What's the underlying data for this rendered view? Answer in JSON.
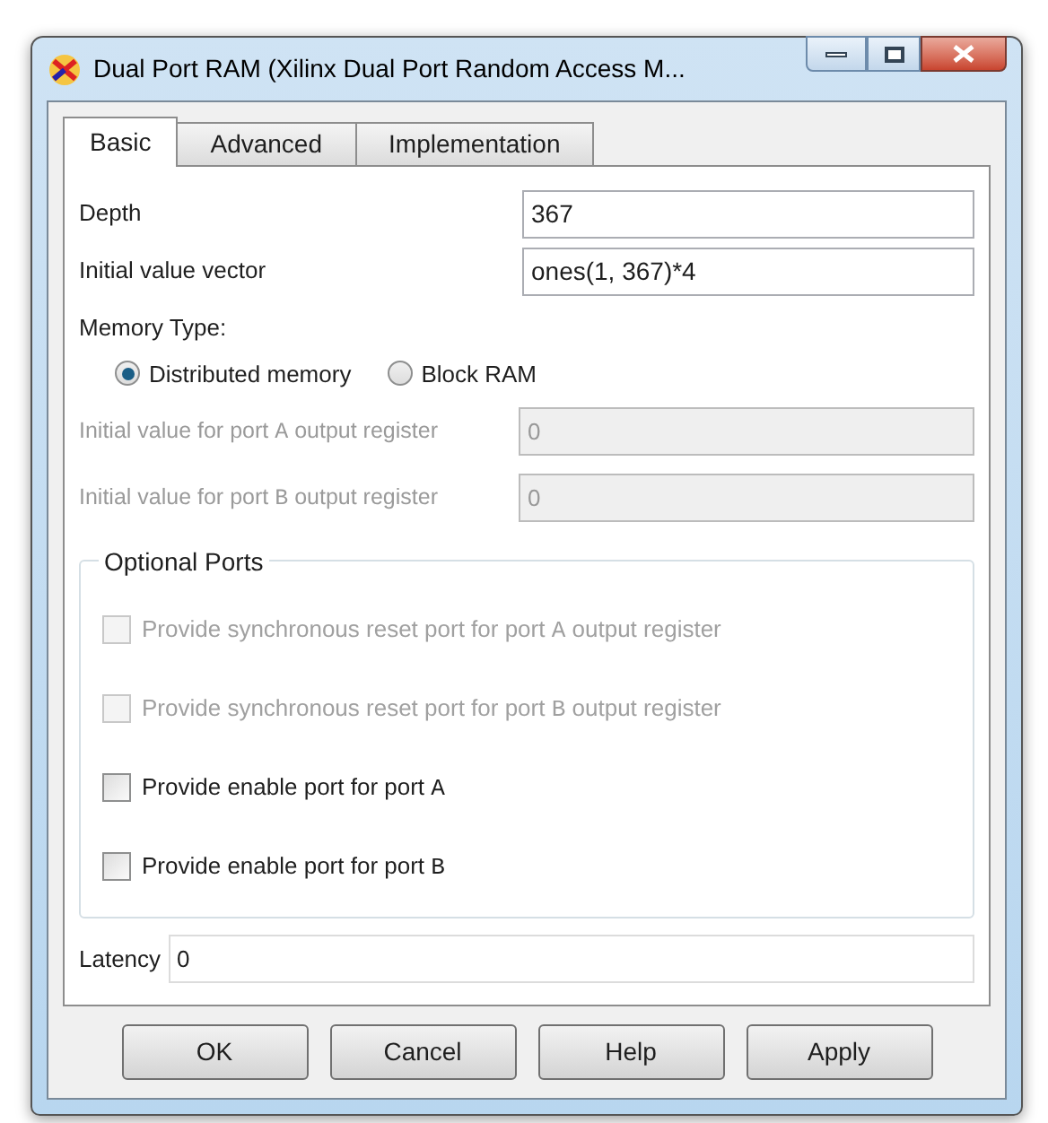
{
  "window": {
    "title": "Dual Port RAM (Xilinx Dual Port Random Access M..."
  },
  "tabs": [
    {
      "label": "Basic",
      "selected": true
    },
    {
      "label": "Advanced",
      "selected": false
    },
    {
      "label": "Implementation",
      "selected": false
    }
  ],
  "fields": [
    {
      "label": "Depth",
      "value": "367",
      "disabled": false
    },
    {
      "label": "Initial value vector",
      "value": "ones(1, 367)*4",
      "disabled": false
    }
  ],
  "memory_type": {
    "label": "Memory Type:",
    "options": [
      {
        "label": "Distributed memory",
        "selected": true
      },
      {
        "label": "Block RAM",
        "selected": false
      }
    ]
  },
  "port_fields": [
    {
      "label": "Initial value for port ",
      "port": "A",
      "suffix": " output register",
      "value": "0",
      "disabled": true
    },
    {
      "label": "Initial value for port ",
      "port": "B",
      "suffix": " output register",
      "value": "0",
      "disabled": true
    }
  ],
  "optional_ports": {
    "title": "Optional Ports",
    "items": [
      {
        "label": "Provide synchronous reset port for port ",
        "port": "A",
        "suffix": " output register",
        "checked": false,
        "disabled": true
      },
      {
        "label": "Provide synchronous reset port for port ",
        "port": "B",
        "suffix": " output register",
        "checked": false,
        "disabled": true
      },
      {
        "label": "Provide enable port for port ",
        "port": "A",
        "checked": false,
        "disabled": false
      },
      {
        "label": "Provide enable port for port ",
        "port": "B",
        "checked": false,
        "disabled": false
      }
    ]
  },
  "latency": {
    "label": "Latency",
    "value": "0"
  },
  "buttons": [
    "OK",
    "Cancel",
    "Help",
    "Apply"
  ]
}
